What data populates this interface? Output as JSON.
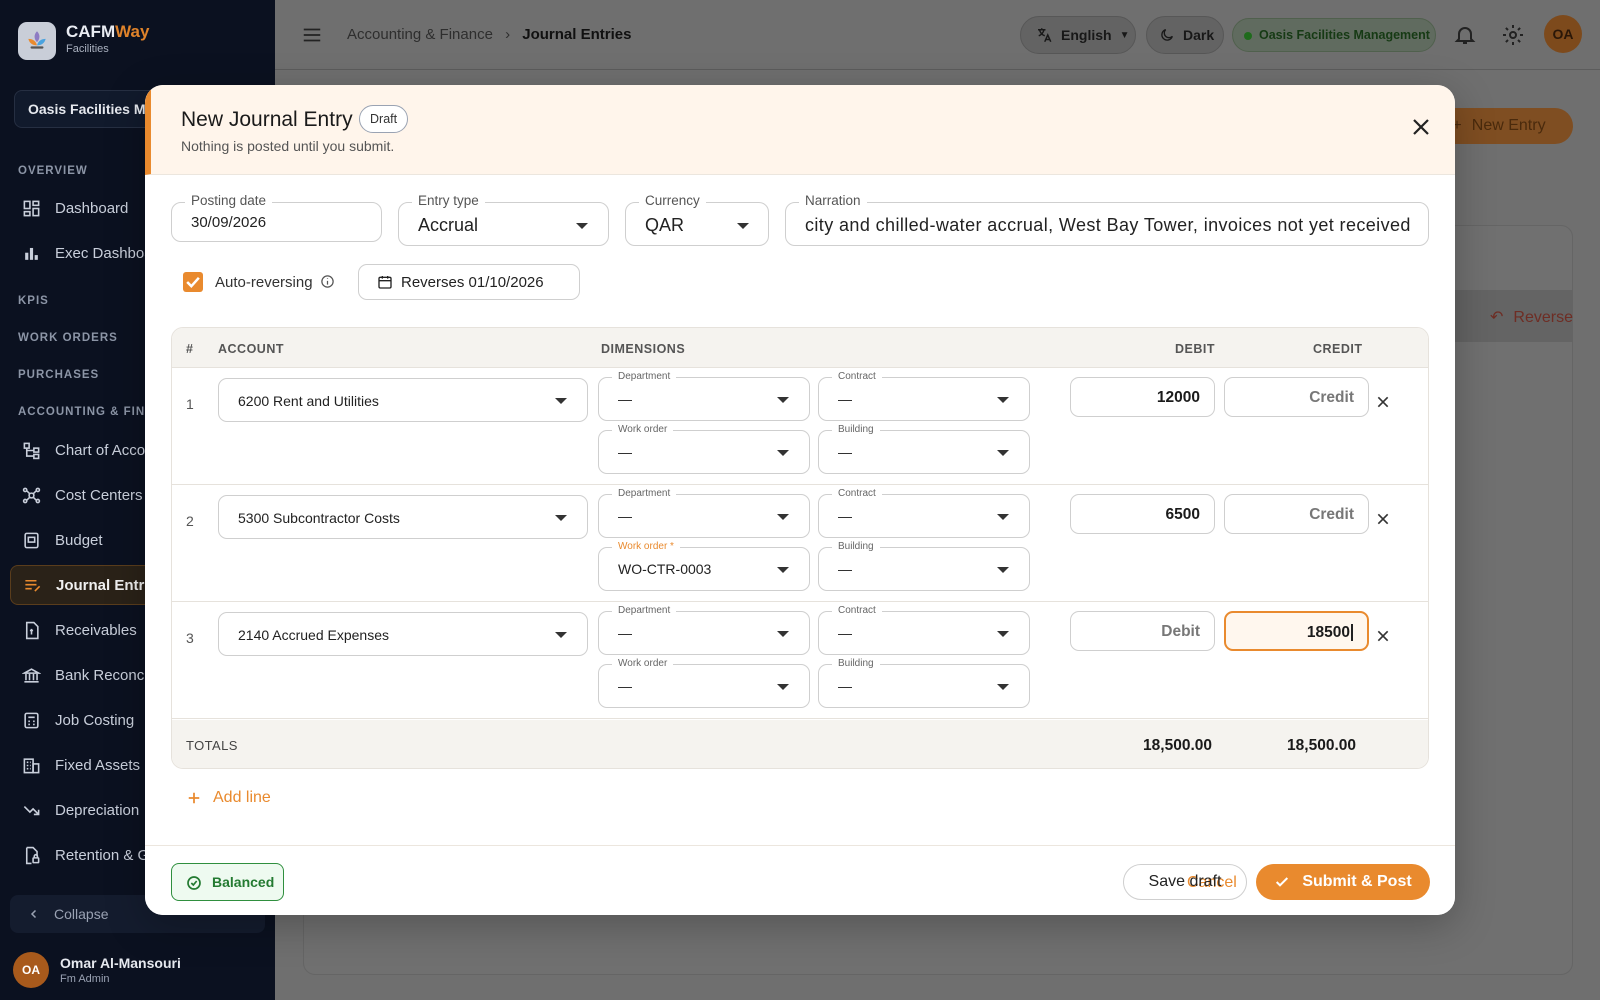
{
  "brand": {
    "name_main": "CAFM",
    "name_accent": "Way",
    "sub": "Facilities"
  },
  "sidebar": {
    "org": "Oasis Facilities Management",
    "sections": [
      "OVERVIEW",
      "KPIS",
      "WORK ORDERS",
      "PURCHASES",
      "ACCOUNTING & FINANCE"
    ],
    "items": [
      {
        "label": "Dashboard",
        "icon": "dashboard-icon"
      },
      {
        "label": "Exec Dashboard",
        "icon": "bar-chart-icon"
      },
      {
        "label": "Chart of Accounts",
        "icon": "hierarchy-icon"
      },
      {
        "label": "Cost Centers",
        "icon": "network-icon"
      },
      {
        "label": "Budget",
        "icon": "budget-icon"
      },
      {
        "label": "Journal Entries",
        "icon": "journal-icon",
        "active": true
      },
      {
        "label": "Receivables",
        "icon": "receivables-icon"
      },
      {
        "label": "Bank Reconciliation",
        "icon": "bank-icon"
      },
      {
        "label": "Job Costing",
        "icon": "calculator-icon"
      },
      {
        "label": "Fixed Assets",
        "icon": "building-icon"
      },
      {
        "label": "Depreciation",
        "icon": "trend-down-icon"
      },
      {
        "label": "Retention & Guarantees",
        "icon": "lock-icon"
      }
    ],
    "collapse": "Collapse",
    "user": {
      "initials": "OA",
      "name": "Omar Al-Mansouri",
      "role": "Fm Admin"
    }
  },
  "topbar": {
    "breadcrumb_parent": "Accounting & Finance",
    "breadcrumb_current": "Journal Entries",
    "language": "English",
    "theme": "Dark",
    "org": "Oasis Facilities Management",
    "avatar": "OA"
  },
  "background": {
    "new_entry": "New Entry",
    "reverse": "Reverse"
  },
  "modal": {
    "title": "New Journal Entry",
    "badge": "Draft",
    "subtitle": "Nothing is posted until you submit.",
    "posting_date": {
      "label": "Posting date",
      "value": "30/09/2026"
    },
    "entry_type": {
      "label": "Entry type",
      "value": "Accrual"
    },
    "currency": {
      "label": "Currency",
      "value": "QAR"
    },
    "narration": {
      "label": "Narration",
      "value": "city and chilled-water accrual, West Bay Tower, invoices not yet received"
    },
    "auto_reversing": {
      "label": "Auto-reversing",
      "checked": true
    },
    "reverses": "Reverses 01/10/2026",
    "table": {
      "headers": {
        "num": "#",
        "account": "ACCOUNT",
        "dimensions": "DIMENSIONS",
        "debit": "DEBIT",
        "credit": "CREDIT"
      },
      "dim_labels": {
        "department": "Department",
        "contract": "Contract",
        "work_order": "Work order",
        "work_order_required": "Work order *",
        "building": "Building"
      },
      "rows": [
        {
          "num": "1",
          "account": "6200  Rent and Utilities",
          "department": "—",
          "contract": "—",
          "work_order": "—",
          "building": "—",
          "debit": "12000",
          "credit": "Credit"
        },
        {
          "num": "2",
          "account": "5300  Subcontractor Costs",
          "department": "—",
          "contract": "—",
          "work_order": "WO-CTR-0003",
          "building": "—",
          "debit": "6500",
          "credit": "Credit"
        },
        {
          "num": "3",
          "account": "2140  Accrued Expenses",
          "department": "—",
          "contract": "—",
          "work_order": "—",
          "building": "—",
          "debit": "Debit",
          "credit": "18500"
        }
      ],
      "totals": {
        "label": "TOTALS",
        "debit": "18,500.00",
        "credit": "18,500.00"
      }
    },
    "add_line": "Add line",
    "status": "Balanced",
    "cancel": "Cancel",
    "save_draft": "Save draft",
    "submit": "Submit & Post"
  },
  "colors": {
    "accent": "#e98a2e",
    "sidebar_bg": "#0b1120",
    "success": "#2f8f3e"
  }
}
